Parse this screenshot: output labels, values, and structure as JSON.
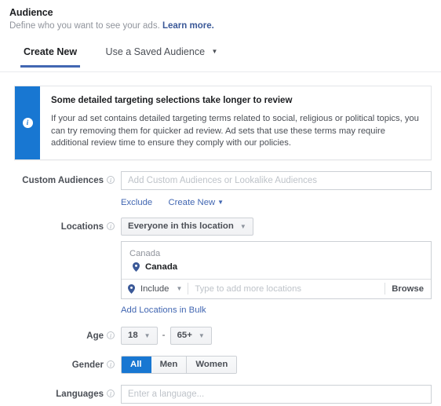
{
  "header": {
    "title": "Audience",
    "subtitle": "Define who you want to see your ads.",
    "learn_more": "Learn more."
  },
  "tabs": [
    {
      "label": "Create New",
      "active": true
    },
    {
      "label": "Use a Saved Audience",
      "active": false,
      "caret": "▼"
    }
  ],
  "banner": {
    "icon": "info-icon",
    "title": "Some detailed targeting selections take longer to review",
    "text": "If your ad set contains detailed targeting terms related to social, religious or political topics, you can try removing them for quicker ad review. Ad sets that use these terms may require additional review time to ensure they comply with our policies.",
    "bar_color": "#1877d2"
  },
  "custom_audiences": {
    "label": "Custom Audiences",
    "placeholder": "Add Custom Audiences or Lookalike Audiences",
    "value": "",
    "exclude_link": "Exclude",
    "create_new_link": "Create New",
    "create_new_caret": "▼"
  },
  "locations": {
    "label": "Locations",
    "scope_select": "Everyone in this location",
    "scope_caret": "▼",
    "group_label": "Canada",
    "selected": [
      {
        "name": "Canada",
        "icon": "map-pin-icon"
      }
    ],
    "include_select": "Include",
    "include_caret": "▼",
    "typeahead_placeholder": "Type to add more locations",
    "typeahead_value": "",
    "browse_button": "Browse",
    "bulk_link": "Add Locations in Bulk"
  },
  "age": {
    "label": "Age",
    "min": "18",
    "max": "65+",
    "dash": "-",
    "caret": "▼"
  },
  "gender": {
    "label": "Gender",
    "options": [
      {
        "label": "All",
        "selected": true
      },
      {
        "label": "Men",
        "selected": false
      },
      {
        "label": "Women",
        "selected": false
      }
    ],
    "accent": "#1877d2"
  },
  "languages": {
    "label": "Languages",
    "placeholder": "Enter a language...",
    "value": ""
  },
  "info_icon_char": "i"
}
